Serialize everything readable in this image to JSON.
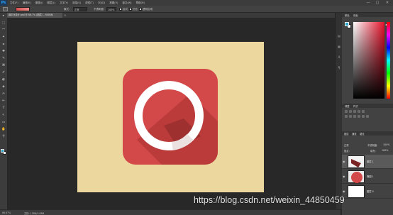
{
  "menubar": {
    "logo": "Ps",
    "items": [
      "文件(F)",
      "编辑(E)",
      "图像(I)",
      "图层(L)",
      "文字(Y)",
      "选择(S)",
      "滤镜(T)",
      "3D(D)",
      "视图(V)",
      "窗口(W)",
      "帮助(H)"
    ],
    "window_controls": [
      "—",
      "□",
      "✕"
    ]
  },
  "options": {
    "mode_label": "模式:",
    "mode_value": "正常",
    "opacity_label": "不透明度:",
    "opacity_value": "100%",
    "reverse_label": "反向",
    "dither_label": "仿色",
    "transparency_label": "透明区域"
  },
  "document": {
    "tab_title": "扁平化设计.psd @ 66.7% (图层 1, RGB/8)",
    "tab_close": "×"
  },
  "tools": [
    "▸",
    "⬚",
    "⌒",
    "✦",
    "⌗",
    "✚",
    "✎",
    "⌘",
    "✐",
    "◐",
    "◈",
    "✍",
    "✏",
    "T",
    "↖",
    "▭",
    "✋",
    "⚲"
  ],
  "status": {
    "zoom": "66.67%",
    "doc_size": "文档:1.76M/4.68M"
  },
  "panels": {
    "color_tab": "颜色",
    "swatches_tab": "色板",
    "adjustments_tab": "调整",
    "styles_tab": "样式",
    "layers_tab": "图层",
    "channels_tab": "通道",
    "paths_tab": "路径",
    "blend_mode": "正常",
    "opacity_label": "不透明度:",
    "opacity_value": "100%",
    "lock_label": "锁定:",
    "fill_label": "填充:",
    "fill_value": "100%",
    "layers": [
      {
        "name": "图层 1"
      },
      {
        "name": "椭圆 1"
      },
      {
        "name": "图层 0"
      }
    ]
  },
  "watermark": "https://blog.csdn.net/weixin_44850459",
  "colors": {
    "canvas_bg": "#ecd89f",
    "icon_red": "#d34848",
    "ring_white": "#ffffff",
    "foreground": "#2aa3c7"
  }
}
